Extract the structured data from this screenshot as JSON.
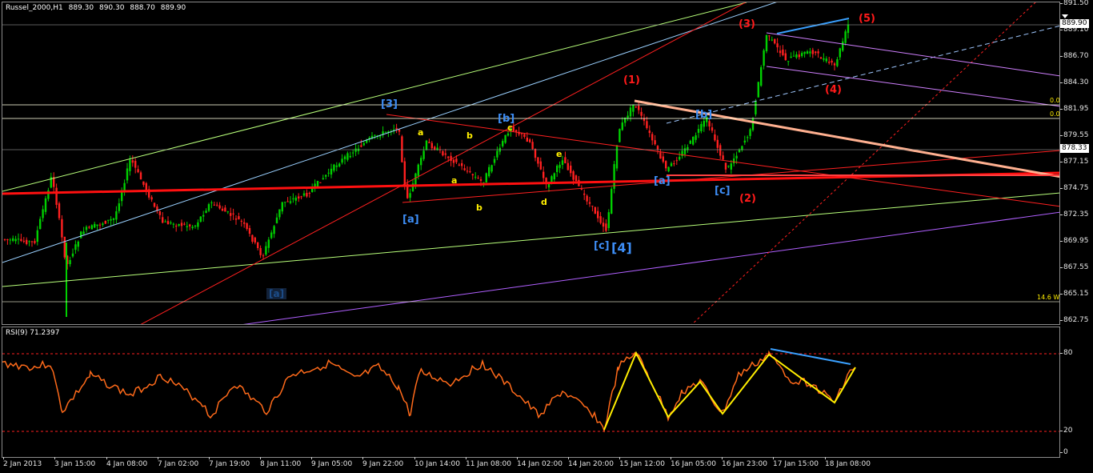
{
  "chart": {
    "symbol_header": "Russel_2000,H1",
    "ohlc": [
      "889.30",
      "890.30",
      "888.70",
      "889.90"
    ],
    "rsi_header": "RSI(9) 71.2397"
  },
  "price_axis": {
    "ticks": [
      "891.50",
      "889.10",
      "886.70",
      "884.30",
      "881.95",
      "879.55",
      "877.15",
      "874.75",
      "872.35",
      "869.95",
      "867.55",
      "865.15",
      "862.75"
    ],
    "current_price": "889.90",
    "marker_price": "878.33"
  },
  "rsi_axis": {
    "ticks": [
      "80",
      "20",
      "0"
    ]
  },
  "time_axis": {
    "labels": [
      "2 Jan 2013",
      "3 Jan 15:00",
      "4 Jan 08:00",
      "7 Jan 02:00",
      "7 Jan 19:00",
      "8 Jan 11:00",
      "9 Jan 05:00",
      "9 Jan 22:00",
      "10 Jan 14:00",
      "11 Jan 08:00",
      "14 Jan 02:00",
      "14 Jan 20:00",
      "15 Jan 12:00",
      "16 Jan 05:00",
      "16 Jan 23:00",
      "17 Jan 15:00",
      "18 Jan 08:00"
    ]
  },
  "fib_labels": {
    "level_a": "0.0",
    "level_b": "0.0",
    "footer": "14.6 W"
  },
  "wave_labels": {
    "red_1": "(1)",
    "red_2": "(2)",
    "red_3": "(3)",
    "red_4": "(4)",
    "red_5": "(5)",
    "blue_3": "[3]",
    "blue_4": "[4]",
    "blue_a1": "[a]",
    "blue_b1": "[b]",
    "blue_c1": "[c]",
    "blue_a2": "[a]",
    "blue_b2": "[b]",
    "blue_c2": "[c]",
    "navy_a": "[a]",
    "yel_a1": "a",
    "yel_b1": "b",
    "yel_c1": "c",
    "yel_a2": "a",
    "yel_b2": "b",
    "yel_c2": "c",
    "yel_d": "d",
    "yel_e": "e"
  },
  "colors": {
    "background": "#000000",
    "bull_candle": "#00d000",
    "bear_candle": "#ff2020",
    "rsi_line": "#ff6a1a",
    "wave_red": "#ff1a1a",
    "wave_blue": "#3d8df5",
    "wave_yellow": "#ffee00"
  },
  "icons": {
    "bid_marker": "triangle-down-icon"
  }
}
